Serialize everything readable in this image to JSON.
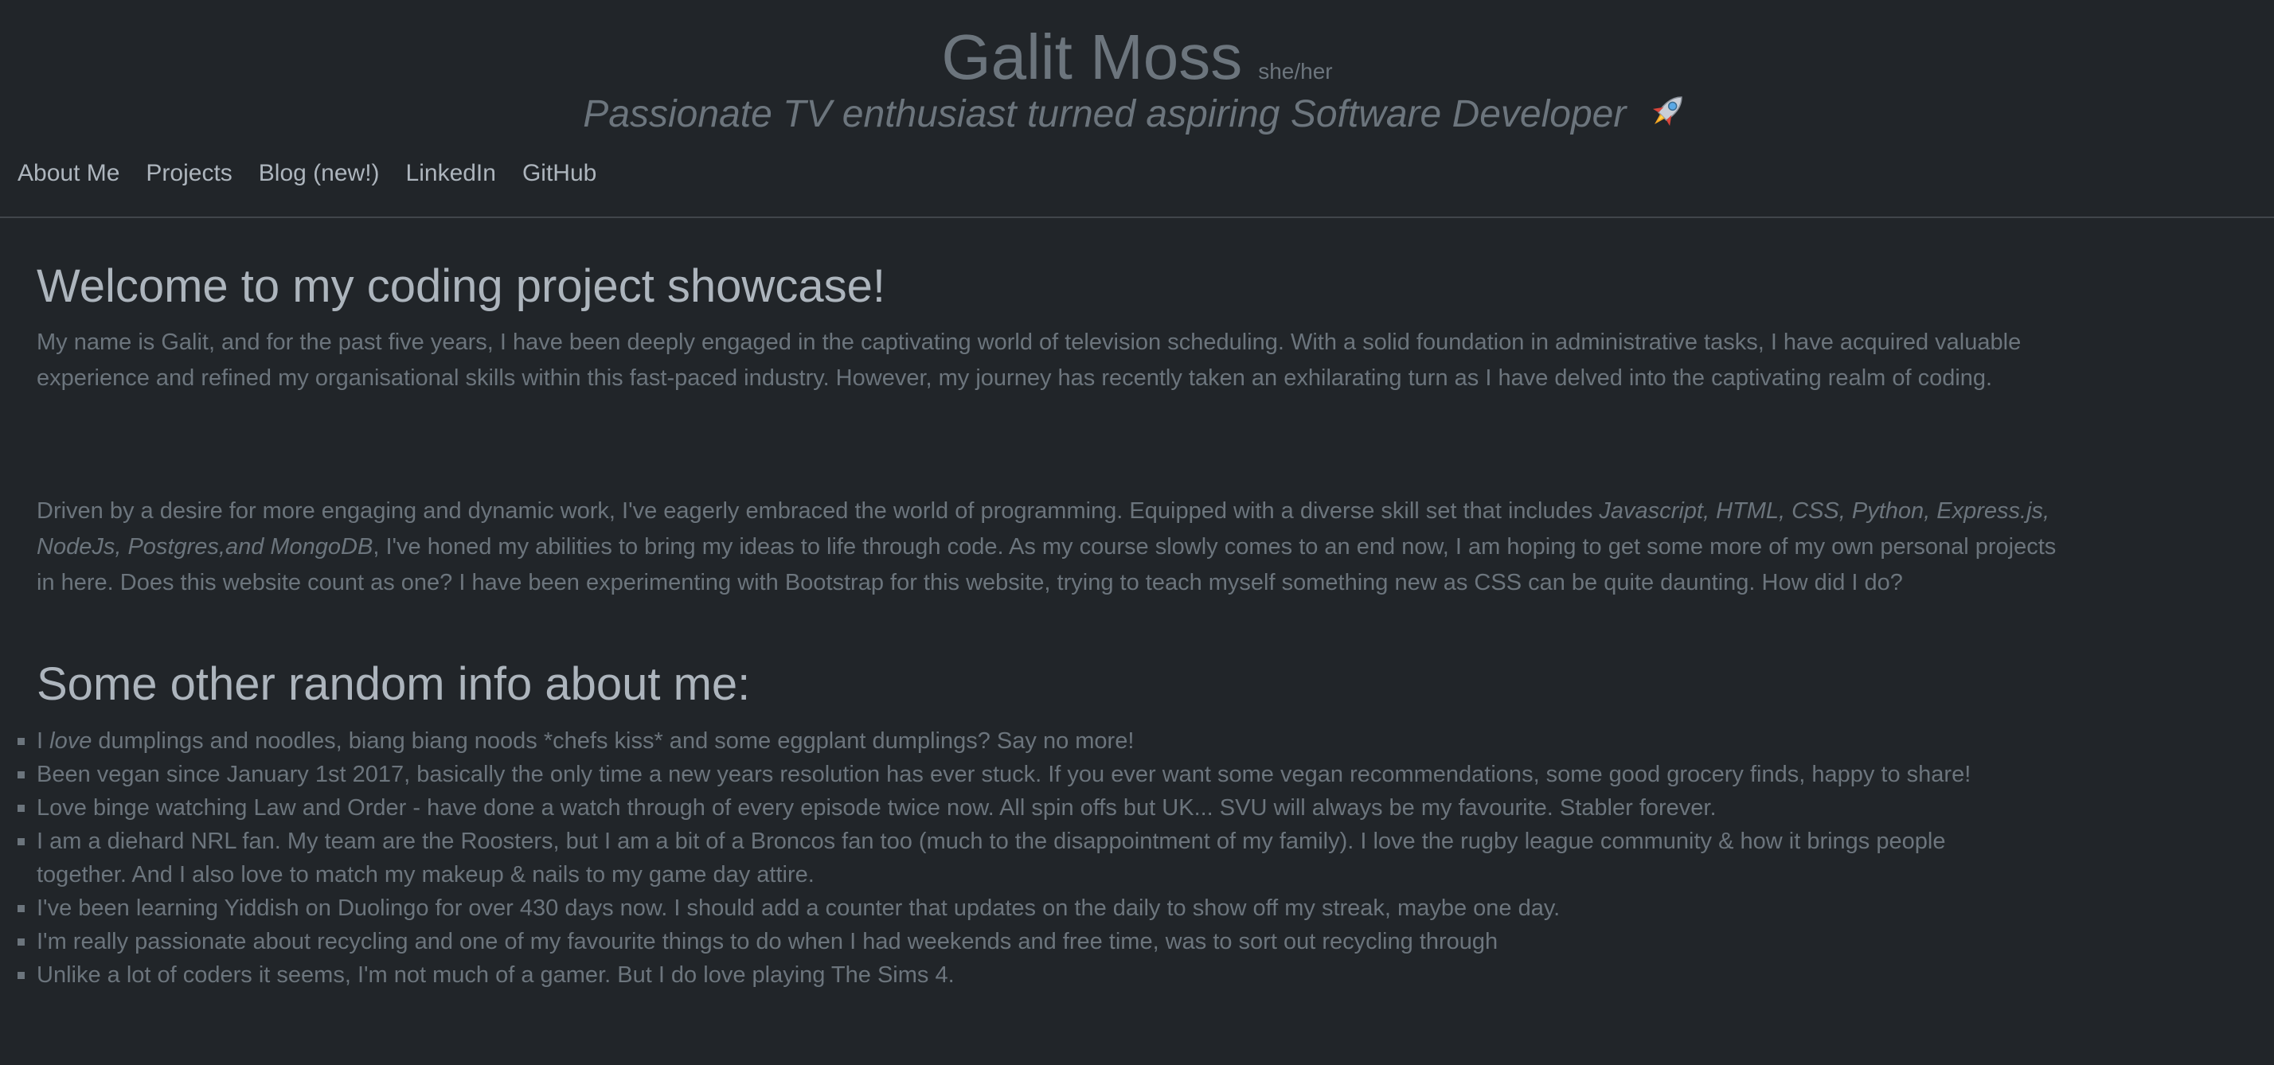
{
  "header": {
    "name": "Galit Moss",
    "pronouns": "she/her",
    "tagline": "Passionate TV enthusiast turned aspiring Software Developer"
  },
  "nav": {
    "items": [
      "About Me",
      "Projects",
      "Blog (new!)",
      "LinkedIn",
      "GitHub"
    ]
  },
  "main": {
    "welcome_heading": "Welcome to my coding project showcase!",
    "p1": "My name is Galit, and for the past five years, I have been deeply engaged in the captivating world of television scheduling. With a solid foundation in administrative tasks, I have acquired valuable experience and refined my organisational skills within this fast-paced industry. However, my journey has recently taken an exhilarating turn as I have delved into the captivating realm of coding.",
    "p2_before": "Driven by a desire for more engaging and dynamic work, I've eagerly embraced the world of programming. Equipped with a diverse skill set that includes ",
    "p2_skills": "Javascript, HTML, CSS, Python, Express.js, NodeJs, Postgres,and MongoDB",
    "p2_after": ", I've honed my abilities to bring my ideas to life through code. As my course slowly comes to an end now, I am hoping to get some more of my own personal projects in here. Does this website count as one? I have been experimenting with Bootstrap for this website, trying to teach myself something new as CSS can be quite daunting. How did I do?",
    "random_heading": "Some other random info about me:",
    "facts": {
      "f1_prefix": "I ",
      "f1_emph": "love",
      "f1_rest": " dumplings and noodles, biang biang noods *chefs kiss* and some eggplant dumplings? Say no more!",
      "f2": "Been vegan since January 1st 2017, basically the only time a new years resolution has ever stuck. If you ever want some vegan recommendations, some good grocery finds, happy to share!",
      "f3": "Love binge watching Law and Order - have done a watch through of every episode twice now. All spin offs but UK... SVU will always be my favourite. Stabler forever.",
      "f4": "I am a diehard NRL fan. My team are the Roosters, but I am a bit of a Broncos fan too (much to the disappointment of my family). I love the rugby league community & how it brings people together. And I also love to match my makeup & nails to my game day attire.",
      "f5": "I've been learning Yiddish on Duolingo for over 430 days now. I should add a counter that updates on the daily to show off my streak, maybe one day.",
      "f6": "I'm really passionate about recycling and one of my favourite things to do when I had weekends and free time, was to sort out recycling through",
      "f7": "Unlike a lot of coders it seems, I'm not much of a gamer. But I do love playing The Sims 4."
    }
  },
  "colors": {
    "background": "#212529",
    "muted_text": "#6c757d",
    "light_text": "#adb5bd",
    "divider": "#41464b"
  },
  "icons": {
    "tagline_emoji": "rocket-icon"
  }
}
